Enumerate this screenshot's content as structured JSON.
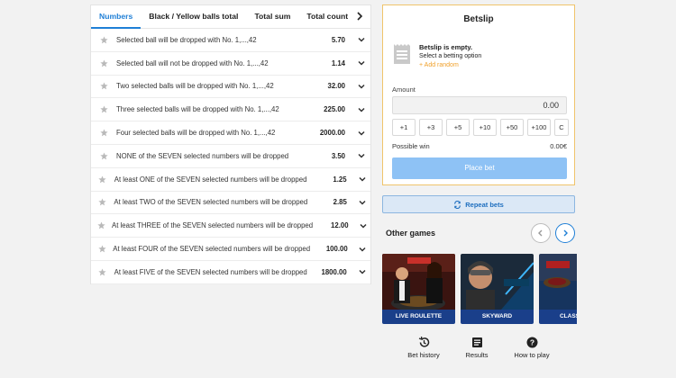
{
  "tabs": [
    "Numbers",
    "Black / Yellow balls total",
    "Total sum",
    "Total count"
  ],
  "bets": [
    {
      "label": "Selected ball will be dropped with No. 1,...,42",
      "odd": "5.70"
    },
    {
      "label": "Selected ball will not be dropped with No. 1,...,42",
      "odd": "1.14"
    },
    {
      "label": "Two selected balls will be dropped with No. 1,...,42",
      "odd": "32.00"
    },
    {
      "label": "Three selected balls will be dropped with No. 1,...,42",
      "odd": "225.00"
    },
    {
      "label": "Four selected balls will be dropped with No. 1,...,42",
      "odd": "2000.00"
    },
    {
      "label": "NONE of the SEVEN selected numbers will be dropped",
      "odd": "3.50"
    },
    {
      "label": "At least ONE of the SEVEN selected numbers will be dropped",
      "odd": "1.25"
    },
    {
      "label": "At least TWO of the SEVEN selected numbers will be dropped",
      "odd": "2.85"
    },
    {
      "label": "At least THREE of the SEVEN selected numbers will be dropped",
      "odd": "12.00"
    },
    {
      "label": "At least FOUR of the SEVEN selected numbers will be dropped",
      "odd": "100.00"
    },
    {
      "label": "At least FIVE of the SEVEN selected numbers will be dropped",
      "odd": "1800.00"
    }
  ],
  "betslip": {
    "title": "Betslip",
    "empty_title": "Betslip is empty.",
    "empty_hint": "Select a betting option",
    "add_random": "+ Add random",
    "amount_label": "Amount",
    "amount_value": "0.00",
    "chips": [
      "+1",
      "+3",
      "+5",
      "+10",
      "+50",
      "+100",
      "C"
    ],
    "possible_win_label": "Possible win",
    "possible_win_value": "0.00€",
    "place_bet": "Place bet"
  },
  "repeat_bets": "Repeat bets",
  "other_games": {
    "title": "Other games",
    "games": [
      "LIVE ROULETTE",
      "SKYWARD",
      "CLASSIC R"
    ]
  },
  "bottom_nav": [
    "Bet history",
    "Results",
    "How to play"
  ],
  "colors": {
    "accent": "#1f7fd6",
    "betslip_border": "#f0c46b",
    "place_bet": "#8ec2f5",
    "add_random": "#f0a02a"
  }
}
